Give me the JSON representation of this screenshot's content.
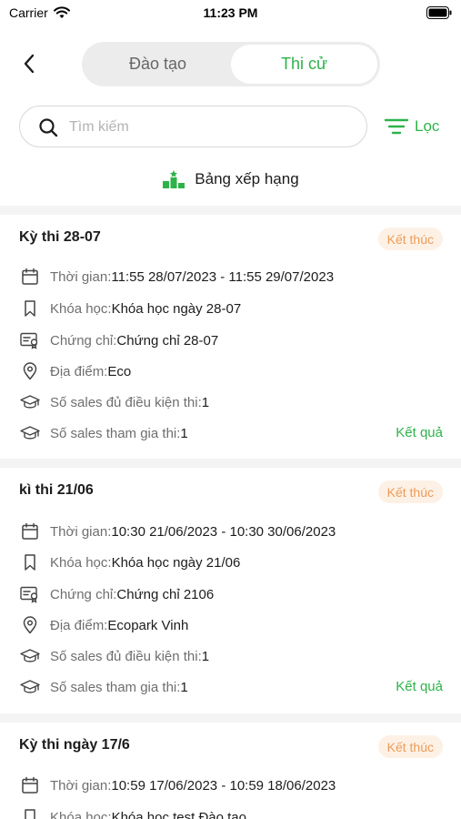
{
  "status_bar": {
    "carrier": "Carrier",
    "time": "11:23 PM"
  },
  "header": {
    "tabs": [
      {
        "label": "Đào tạo",
        "selected": false
      },
      {
        "label": "Thi cử",
        "selected": true
      }
    ]
  },
  "search": {
    "placeholder": "Tìm kiếm",
    "value": ""
  },
  "filter": {
    "label": "Lọc"
  },
  "ranking": {
    "label": "Bảng xếp hạng"
  },
  "labels": {
    "time": "Thời gian:",
    "course": "Khóa học:",
    "certificate": "Chứng chỉ:",
    "location": "Địa điểm:",
    "eligible": "Số sales đủ điều kiện thi:",
    "participants": "Số sales tham gia thi:",
    "result": "Kết quả"
  },
  "exams": [
    {
      "title": "Kỳ thi 28-07",
      "status": "Kết thúc",
      "time": "11:55 28/07/2023 - 11:55 29/07/2023",
      "course": "Khóa học ngày 28-07",
      "certificate": "Chứng chỉ 28-07",
      "location": "Eco",
      "eligible": "1",
      "participants": "1"
    },
    {
      "title": "kì thi 21/06",
      "status": "Kết thúc",
      "time": "10:30 21/06/2023 - 10:30 30/06/2023",
      "course": "Khóa học ngày 21/06",
      "certificate": "Chứng chỉ 2106",
      "location": "Ecopark Vinh",
      "eligible": "1",
      "participants": "1"
    },
    {
      "title": "Kỳ thi ngày 17/6",
      "status": "Kết thúc",
      "time": "10:59 17/06/2023 - 10:59 18/06/2023",
      "course": "Khóa học test Đào tạo"
    }
  ],
  "colors": {
    "accent": "#2db34a",
    "badge_text": "#ee9b57",
    "badge_bg": "#fdf1e6"
  }
}
